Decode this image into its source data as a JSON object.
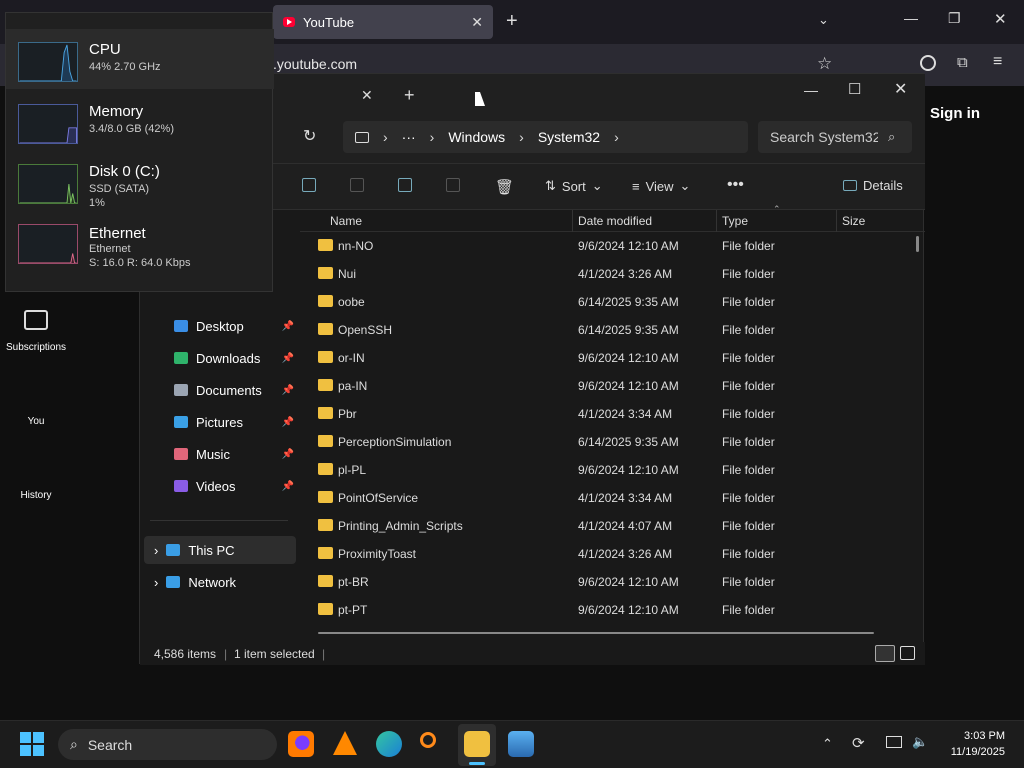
{
  "browser": {
    "tab_title": "YouTube",
    "url": ".youtube.com",
    "sign_in": "Sign in",
    "side": [
      {
        "label": "Subscriptions"
      },
      {
        "label": "You"
      },
      {
        "label": "History"
      }
    ]
  },
  "task_manager": [
    {
      "name": "CPU",
      "line1": "44% 2.70 GHz",
      "line2": ""
    },
    {
      "name": "Memory",
      "line1": "3.4/8.0 GB (42%)",
      "line2": ""
    },
    {
      "name": "Disk 0 (C:)",
      "line1": "SSD (SATA)",
      "line2": "1%"
    },
    {
      "name": "Ethernet",
      "line1": "Ethernet",
      "line2": "S: 16.0  R: 64.0 Kbps"
    }
  ],
  "explorer": {
    "breadcrumb": [
      "Windows",
      "System32"
    ],
    "search_placeholder": "Search System32",
    "toolbar": {
      "sort": "Sort",
      "view": "View",
      "details": "Details"
    },
    "columns": {
      "name": "Name",
      "date": "Date modified",
      "type": "Type",
      "size": "Size"
    },
    "nav": [
      {
        "label": "Desktop",
        "color": "#3a8ee6"
      },
      {
        "label": "Downloads",
        "color": "#2fb36b"
      },
      {
        "label": "Documents",
        "color": "#9aa4b2"
      },
      {
        "label": "Pictures",
        "color": "#3aa0e6"
      },
      {
        "label": "Music",
        "color": "#e0667a"
      },
      {
        "label": "Videos",
        "color": "#8a5ce6"
      }
    ],
    "tree": [
      {
        "label": "This PC"
      },
      {
        "label": "Network"
      }
    ],
    "rows": [
      {
        "name": "nn-NO",
        "date": "9/6/2024 12:10 AM",
        "type": "File folder"
      },
      {
        "name": "Nui",
        "date": "4/1/2024 3:26 AM",
        "type": "File folder"
      },
      {
        "name": "oobe",
        "date": "6/14/2025 9:35 AM",
        "type": "File folder"
      },
      {
        "name": "OpenSSH",
        "date": "6/14/2025 9:35 AM",
        "type": "File folder"
      },
      {
        "name": "or-IN",
        "date": "9/6/2024 12:10 AM",
        "type": "File folder"
      },
      {
        "name": "pa-IN",
        "date": "9/6/2024 12:10 AM",
        "type": "File folder"
      },
      {
        "name": "Pbr",
        "date": "4/1/2024 3:34 AM",
        "type": "File folder"
      },
      {
        "name": "PerceptionSimulation",
        "date": "6/14/2025 9:35 AM",
        "type": "File folder"
      },
      {
        "name": "pl-PL",
        "date": "9/6/2024 12:10 AM",
        "type": "File folder"
      },
      {
        "name": "PointOfService",
        "date": "4/1/2024 3:34 AM",
        "type": "File folder"
      },
      {
        "name": "Printing_Admin_Scripts",
        "date": "4/1/2024 4:07 AM",
        "type": "File folder"
      },
      {
        "name": "ProximityToast",
        "date": "4/1/2024 3:26 AM",
        "type": "File folder"
      },
      {
        "name": "pt-BR",
        "date": "9/6/2024 12:10 AM",
        "type": "File folder"
      },
      {
        "name": "pt-PT",
        "date": "9/6/2024 12:10 AM",
        "type": "File folder"
      }
    ],
    "status_count": "4,586 items",
    "status_selected": "1 item selected"
  },
  "taskbar": {
    "search": "Search",
    "time": "3:03 PM",
    "date": "11/19/2025"
  }
}
